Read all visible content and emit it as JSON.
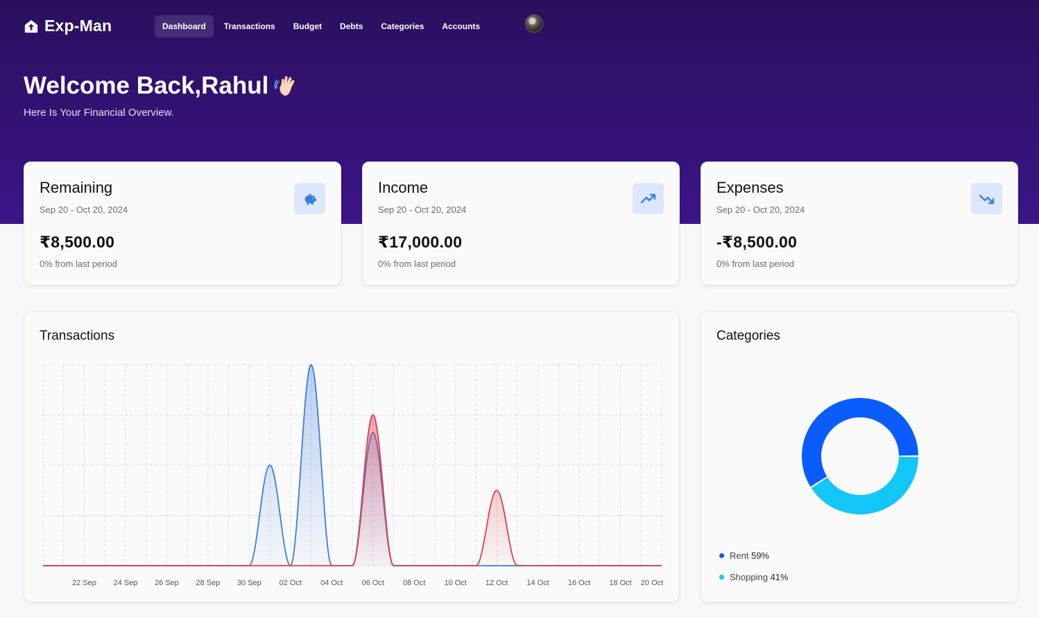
{
  "app": {
    "name": "Exp-Man"
  },
  "nav": {
    "items": [
      {
        "label": "Dashboard",
        "active": true
      },
      {
        "label": "Transactions",
        "active": false
      },
      {
        "label": "Budget",
        "active": false
      },
      {
        "label": "Debts",
        "active": false
      },
      {
        "label": "Categories",
        "active": false
      },
      {
        "label": "Accounts",
        "active": false
      }
    ]
  },
  "header": {
    "welcome": "Welcome Back,Rahul",
    "subtitle": "Here Is Your Financial Overview."
  },
  "stats": [
    {
      "title": "Remaining",
      "date_range": "Sep 20 - Oct 20, 2024",
      "amount": "₹8,500.00",
      "change": "0% from last period",
      "icon": "piggy-bank-icon"
    },
    {
      "title": "Income",
      "date_range": "Sep 20 - Oct 20, 2024",
      "amount": "₹17,000.00",
      "change": "0% from last period",
      "icon": "trending-up-icon"
    },
    {
      "title": "Expenses",
      "date_range": "Sep 20 - Oct 20, 2024",
      "amount": "-₹8,500.00",
      "change": "0% from last period",
      "icon": "trending-down-icon"
    }
  ],
  "transactions": {
    "title": "Transactions"
  },
  "categories": {
    "title": "Categories",
    "legend": [
      {
        "name": "Rent",
        "percent": "59%",
        "color": "#0b5cff"
      },
      {
        "name": "Shopping",
        "percent": "41%",
        "color": "#12c6f7"
      }
    ]
  },
  "colors": {
    "income": "#3b7ddd",
    "expense": "#e23b4f",
    "accent_bg": "#dce7fb",
    "accent_icon": "#3b7ddd"
  },
  "chart_data": [
    {
      "type": "area",
      "categories": [
        "22 Sep",
        "24 Sep",
        "26 Sep",
        "28 Sep",
        "30 Sep",
        "02 Oct",
        "04 Oct",
        "06 Oct",
        "08 Oct",
        "10 Oct",
        "12 Oct",
        "14 Oct",
        "16 Oct",
        "18 Oct",
        "20 Oct"
      ],
      "x": [
        "20 Sep",
        "21 Sep",
        "22 Sep",
        "23 Sep",
        "24 Sep",
        "25 Sep",
        "26 Sep",
        "27 Sep",
        "28 Sep",
        "29 Sep",
        "30 Sep",
        "01 Oct",
        "02 Oct",
        "03 Oct",
        "04 Oct",
        "05 Oct",
        "06 Oct",
        "07 Oct",
        "08 Oct",
        "09 Oct",
        "10 Oct",
        "11 Oct",
        "12 Oct",
        "13 Oct",
        "14 Oct",
        "15 Oct",
        "16 Oct",
        "17 Oct",
        "18 Oct",
        "19 Oct",
        "20 Oct"
      ],
      "series": [
        {
          "values": [
            0,
            0,
            0,
            0,
            0,
            0,
            0,
            0,
            0,
            0,
            0,
            0,
            0,
            0,
            0,
            0,
            0,
            0,
            0,
            0,
            0,
            0,
            0,
            0,
            0,
            0,
            0,
            0,
            0,
            0,
            0
          ],
          "peaks": [
            [
              3,
              4,
              "01 Oct",
              4,
              "03 Oct",
              8,
              "06 Oct",
              5.3
            ]
          ]
        },
        {
          "values": [
            0,
            0,
            0,
            0,
            0,
            0,
            0,
            0,
            0,
            0,
            0,
            0,
            0,
            0,
            0,
            0,
            0,
            0,
            0,
            0,
            0,
            0,
            0,
            0,
            0,
            0,
            0,
            0,
            0,
            0,
            0
          ]
        }
      ],
      "income_values": [
        0,
        0,
        0,
        0,
        0,
        0,
        0,
        0,
        0,
        0,
        0,
        4,
        0,
        8,
        0,
        0,
        5.3,
        0,
        0,
        0,
        0,
        0,
        0,
        0,
        0,
        0,
        0,
        0,
        0,
        0,
        0
      ],
      "expense_values": [
        0,
        0,
        0,
        0,
        0,
        0,
        0,
        0,
        0,
        0,
        0,
        0,
        0,
        0,
        0,
        0,
        6,
        0,
        0,
        0,
        0,
        0,
        3,
        0,
        0,
        0,
        0,
        0,
        0,
        0,
        0
      ],
      "ylim": [
        0,
        8
      ],
      "grid": true
    },
    {
      "type": "pie",
      "categories": [
        "Rent",
        "Shopping"
      ],
      "values": [
        59,
        41
      ]
    }
  ]
}
